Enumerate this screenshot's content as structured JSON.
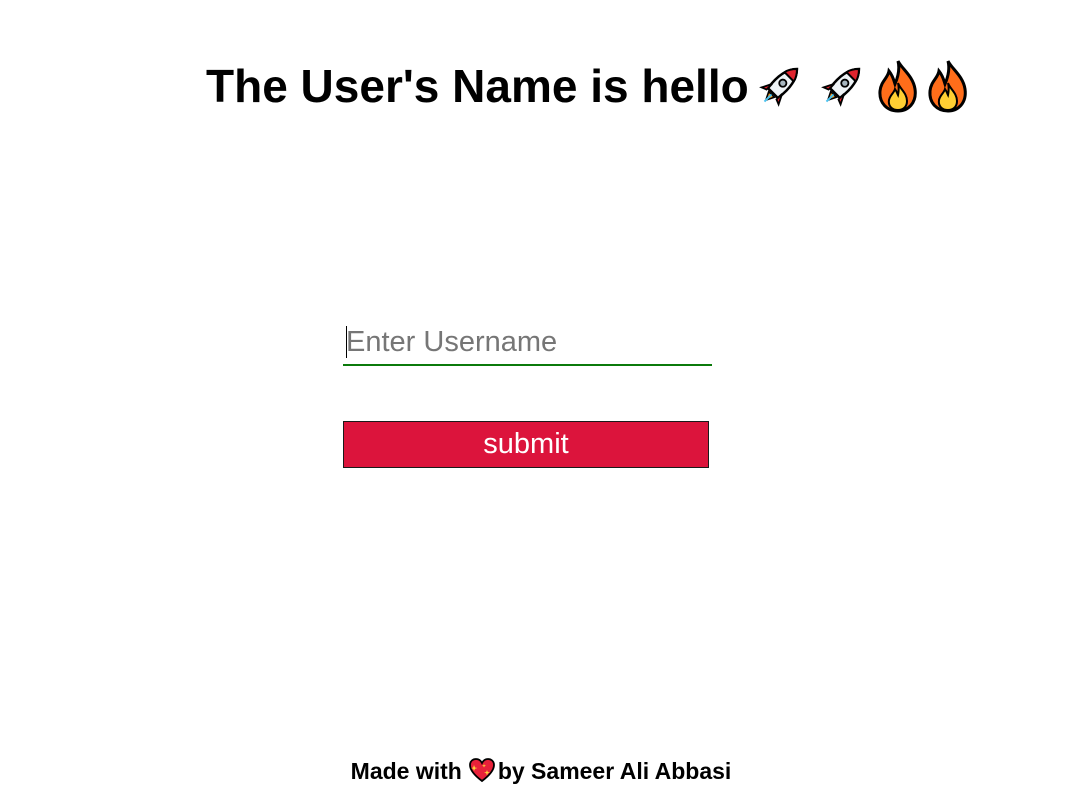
{
  "heading": {
    "text": "The User's Name is hello",
    "emojis": [
      "rocket-icon",
      "rocket-icon",
      "fire-icon",
      "fire-icon"
    ]
  },
  "form": {
    "username_placeholder": "Enter Username",
    "username_value": "",
    "submit_label": "submit",
    "accent_underline_color": "#0b7a0b",
    "button_color": "#dc143c"
  },
  "footer": {
    "prefix": "Made with",
    "heart_icon": "sparkling-heart-icon",
    "suffix": "by Sameer Ali Abbasi"
  }
}
